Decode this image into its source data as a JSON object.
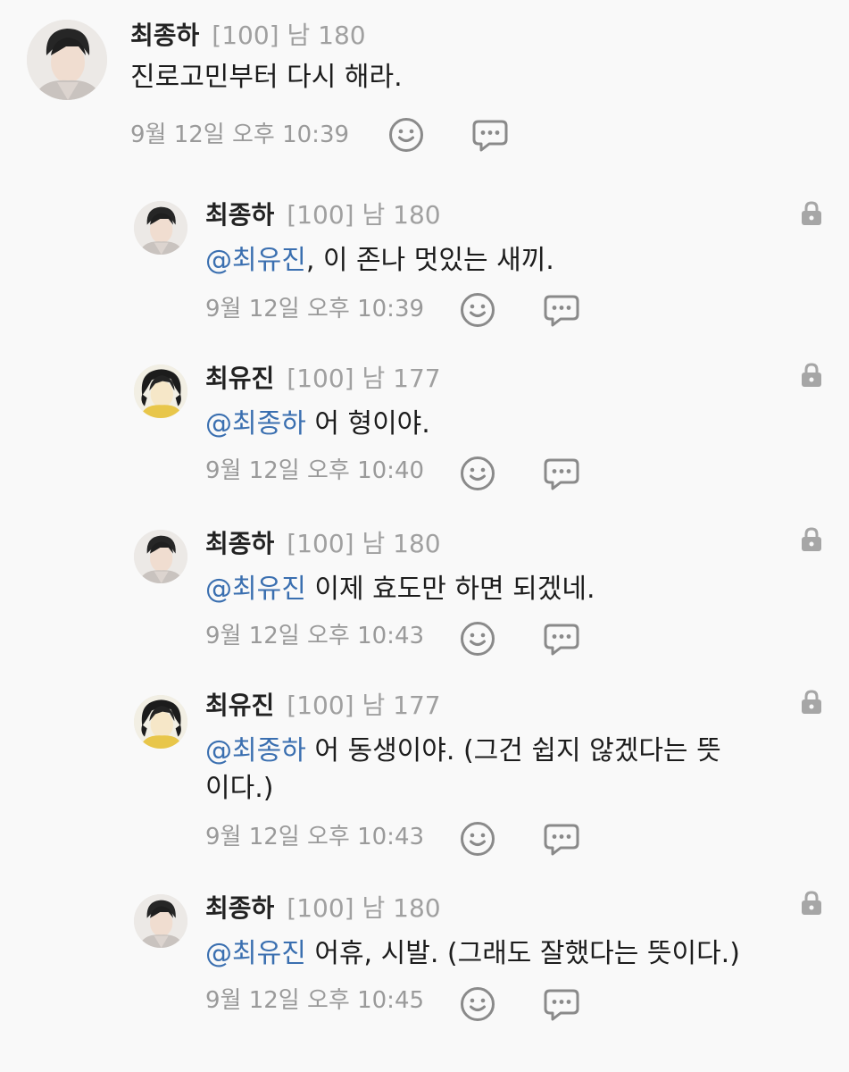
{
  "comments": [
    {
      "author": "최종하",
      "meta": "[100] 남 180",
      "mention": "",
      "text": "진로고민부터 다시 해라.",
      "time": "9월 12일 오후 10:39",
      "avatar": "avatar-jongha",
      "locked": false
    },
    {
      "author": "최종하",
      "meta": "[100] 남 180",
      "mention": "@최유진",
      "text": ", 이 존나 멋있는 새끼.",
      "time": "9월 12일 오후 10:39",
      "avatar": "avatar-jongha",
      "locked": true
    },
    {
      "author": "최유진",
      "meta": "[100] 남 177",
      "mention": "@최종하",
      "text": " 어 형이야.",
      "time": "9월 12일 오후 10:40",
      "avatar": "avatar-yujin",
      "locked": true
    },
    {
      "author": "최종하",
      "meta": "[100] 남 180",
      "mention": "@최유진",
      "text": " 이제 효도만 하면 되겠네.",
      "time": "9월 12일 오후 10:43",
      "avatar": "avatar-jongha",
      "locked": true
    },
    {
      "author": "최유진",
      "meta": "[100] 남 177",
      "mention": "@최종하",
      "text": " 어 동생이야. (그건 쉽지 않겠다는 뜻이다.)",
      "time": "9월 12일 오후 10:43",
      "avatar": "avatar-yujin",
      "locked": true
    },
    {
      "author": "최종하",
      "meta": "[100] 남 180",
      "mention": "@최유진",
      "text": " 어휴, 시발. (그래도 잘했다는 뜻이다.)",
      "time": "9월 12일 오후 10:45",
      "avatar": "avatar-jongha",
      "locked": true
    }
  ],
  "icons": {
    "react": "smile-icon",
    "reply": "speech-bubble-icon",
    "lock": "lock-icon"
  },
  "colors": {
    "background": "#f9f9f9",
    "mention": "#3a6fb0",
    "meta": "#a0a0a0",
    "icon": "#8a8a8a",
    "lock": "#a6a6a6"
  }
}
